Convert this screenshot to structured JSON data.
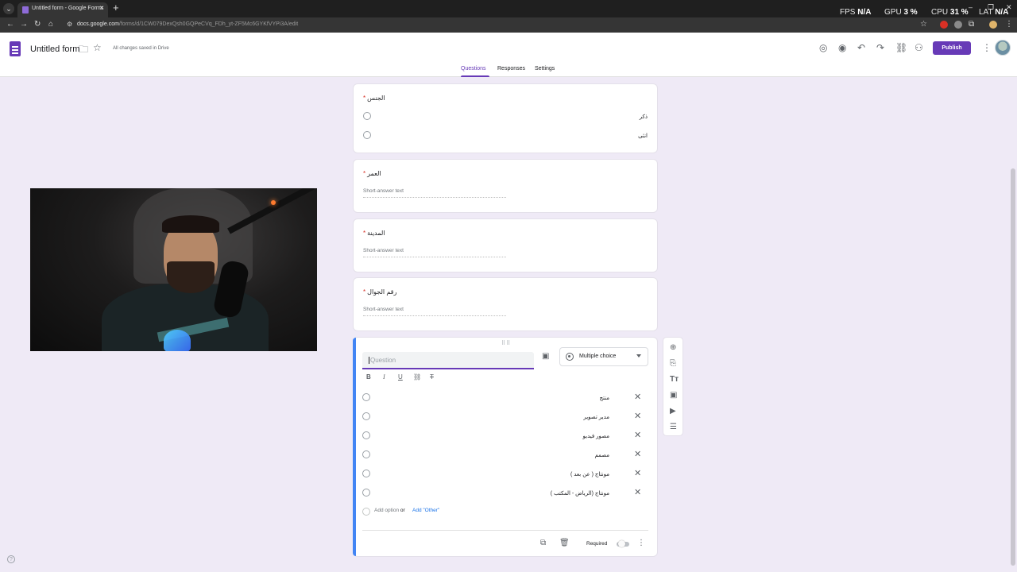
{
  "browser": {
    "tab_title": "Untitled form - Google Forms",
    "url_host": "docs.google.com",
    "url_path": "/forms/d/1CW079DexQsh0GQPeCVq_FDh_yt-ZF5Mc6GYKfVYPi3A/edit",
    "overlay": {
      "fps_label": "FPS",
      "fps_value": "N/A",
      "gpu_label": "GPU",
      "gpu_value": "3 %",
      "cpu_label": "CPU",
      "cpu_value": "31 %",
      "lat_label": "LAT",
      "lat_value": "N/A"
    }
  },
  "header": {
    "title": "Untitled form",
    "saved_status": "All changes saved in Drive",
    "publish_label": "Publish",
    "tabs": [
      "Questions",
      "Responses",
      "Settings"
    ],
    "active_tab": "Questions"
  },
  "questions": [
    {
      "title": "الجنس",
      "required": true,
      "type": "radio",
      "options": [
        "ذكر",
        "انثى"
      ]
    },
    {
      "title": "العمر",
      "required": true,
      "type": "short",
      "placeholder": "Short-answer text"
    },
    {
      "title": "المدينة",
      "required": true,
      "type": "short",
      "placeholder": "Short-answer text"
    },
    {
      "title": "رقم الجوال",
      "required": true,
      "type": "short",
      "placeholder": "Short-answer text"
    }
  ],
  "active_question": {
    "placeholder": "Question",
    "type_label": "Multiple choice",
    "options": [
      "منتج",
      "مدير تصوير",
      "مصور فيديو",
      "مصمم",
      "مونتاج ( عن بعد )",
      "مونتاج (الرياض - المكتب )"
    ],
    "add_option": "Add option",
    "or_text": "or",
    "add_other": "Add \"Other\"",
    "required_label": "Required"
  },
  "colors": {
    "brand": "#673ab7",
    "active_border": "#4285f4",
    "background": "#efeaf6"
  }
}
